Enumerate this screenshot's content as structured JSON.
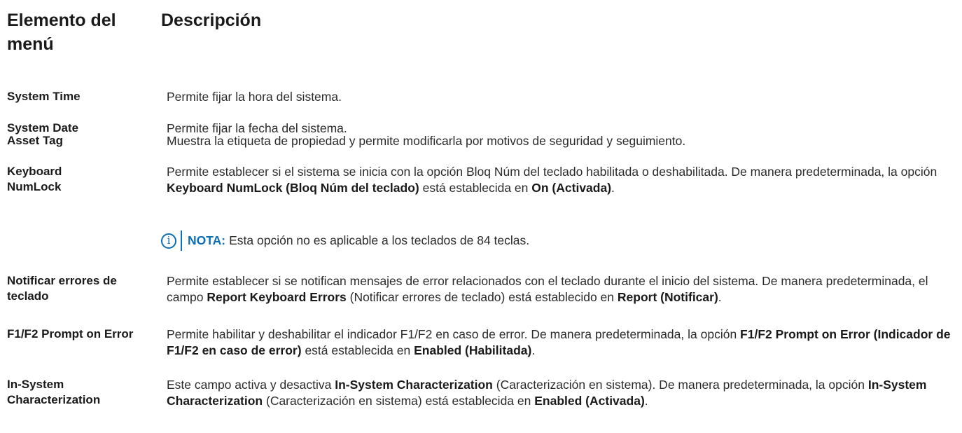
{
  "header": {
    "col1": "Elemento del menú",
    "col2": "Descripción"
  },
  "rows": [
    {
      "label": "System Time",
      "desc": [
        "Permite fijar la hora del sistema."
      ]
    },
    {
      "label": "System Date",
      "desc": [
        "Permite fijar la fecha del sistema."
      ]
    },
    {
      "label": "Asset Tag",
      "desc": [
        "Muestra la etiqueta de propiedad y permite modificarla por motivos de seguridad y seguimiento."
      ]
    },
    {
      "label": "Keyboard NumLock",
      "desc": [
        "Permite establecer si el sistema se inicia con la opción Bloq Núm del teclado habilitada o deshabilitada. De manera predeterminada, la opción ",
        "Keyboard NumLock (Bloq Núm del teclado)",
        " está establecida en ",
        "On (Activada)",
        "."
      ]
    },
    {
      "label": "Notificar errores de teclado",
      "desc": [
        "Permite establecer si se notifican mensajes de error relacionados con el teclado durante el inicio del sistema. De manera predeterminada, el campo ",
        "Report Keyboard Errors",
        " (Notificar errores de teclado) está establecido en ",
        "Report (Notificar)",
        "."
      ]
    },
    {
      "label": "F1/F2 Prompt on Error",
      "desc": [
        "Permite habilitar y deshabilitar el indicador F1/F2 en caso de error. De manera predeterminada, la opción ",
        "F1/F2 Prompt on Error (Indicador de F1/F2 en caso de error)",
        " está establecida en ",
        "Enabled (Habilitada)",
        "."
      ]
    },
    {
      "label": "In-System Characterization",
      "desc": [
        "Este campo activa y desactiva ",
        "In-System Characterization",
        " (Caracterización en sistema). De manera predeterminada, la opción ",
        "In-System Characterization",
        " (Caracterización en sistema) está establecida en ",
        "Enabled (Activada)",
        "."
      ]
    }
  ],
  "note": {
    "label": "NOTA:",
    "text": "Esta opción no es aplicable a los teclados de 84 teclas.",
    "icon": "info-icon",
    "accent": "#0b6fb8"
  }
}
